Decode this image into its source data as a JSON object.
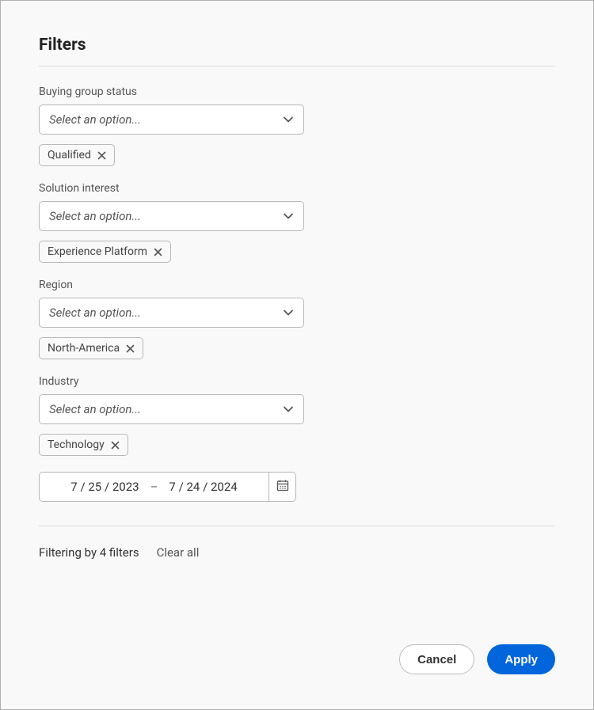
{
  "title": "Filters",
  "fields": [
    {
      "label": "Buying group status",
      "placeholder": "Select an option...",
      "tags": [
        "Qualified"
      ]
    },
    {
      "label": "Solution interest",
      "placeholder": "Select an option...",
      "tags": [
        "Experience Platform"
      ]
    },
    {
      "label": "Region",
      "placeholder": "Select an option...",
      "tags": [
        "North-America"
      ]
    },
    {
      "label": "Industry",
      "placeholder": "Select an option...",
      "tags": [
        "Technology"
      ]
    }
  ],
  "date_range": {
    "start": "7 / 25 / 2023",
    "separator": "–",
    "end": "7 / 24 / 2024"
  },
  "footer": {
    "summary": "Filtering by 4 filters",
    "clear_all": "Clear all"
  },
  "buttons": {
    "cancel": "Cancel",
    "apply": "Apply"
  }
}
